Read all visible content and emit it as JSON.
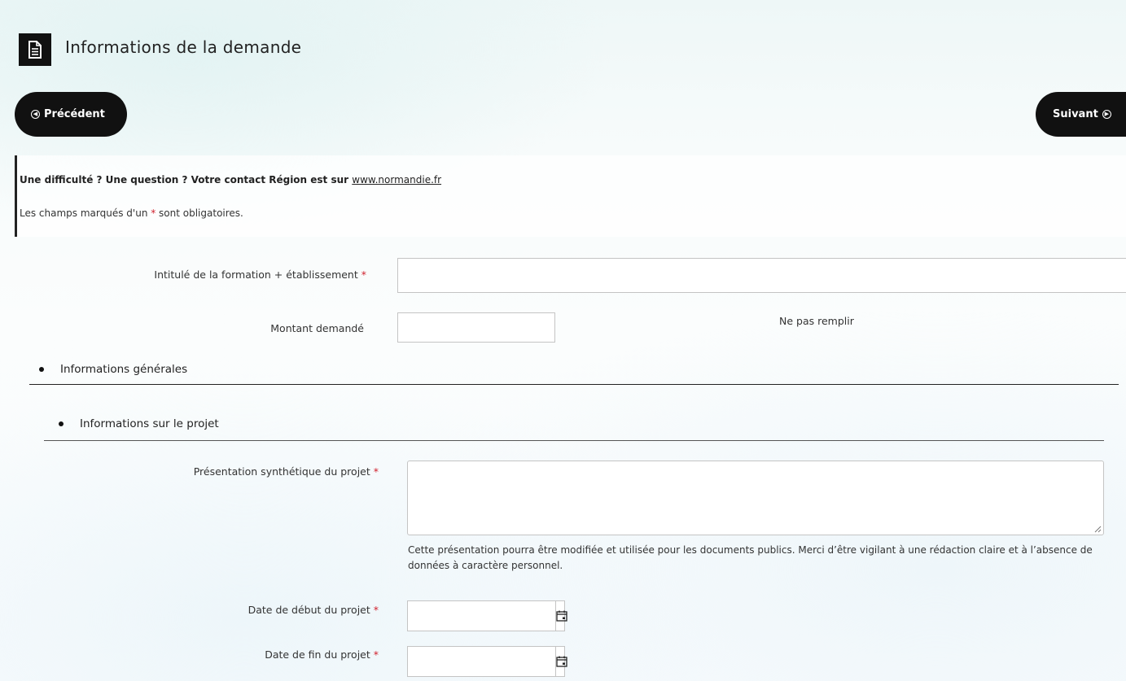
{
  "header": {
    "title": "Informations de la demande",
    "icon": "document-icon"
  },
  "nav": {
    "prev_label": "Précédent",
    "next_label": "Suivant"
  },
  "help": {
    "text": "Une difficulté ? Une question ? Votre contact Région est sur ",
    "link_text": "www.normandie.fr",
    "required_prefix": "Les champs marqués d'un ",
    "required_star": "*",
    "required_suffix": " sont obligatoires."
  },
  "fields": {
    "formation_label": "Intitulé de la formation + établissement",
    "formation_value": "",
    "montant_label": "Montant demandé",
    "montant_value": "",
    "montant_note": "Ne pas remplir"
  },
  "sections": {
    "general": "Informations générales",
    "project": "Informations sur le projet"
  },
  "project": {
    "presentation_label": "Présentation synthétique du projet",
    "presentation_value": "",
    "presentation_hint": "Cette présentation pourra être modifiée et utilisée pour les documents publics. Merci d’être vigilant à une rédaction claire et à l’absence de données à caractère personnel.",
    "start_label": "Date de début du projet",
    "start_value": "",
    "end_label": "Date de fin du projet",
    "end_value": ""
  },
  "required_marker": "*",
  "colors": {
    "accent_dark": "#111111",
    "required_star": "#d0212d"
  }
}
